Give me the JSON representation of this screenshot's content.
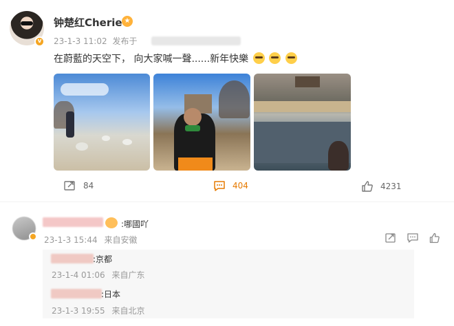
{
  "post": {
    "username": "钟楚红Cherie",
    "badge_icon": "crown-icon",
    "avatar_badge": "v",
    "time": "23-1-3 11:02",
    "source_prefix": "发布于",
    "text": "在蔚藍的天空下， 向大家喊一聲......新年快樂"
  },
  "actions": {
    "reposts": "84",
    "comments": "404",
    "likes": "4231"
  },
  "comment": {
    "text": ":哪國吖",
    "time": "23-1-3 15:44",
    "location": "来自安徽"
  },
  "replies": [
    {
      "text": ":京都",
      "time": "23-1-4 01:06",
      "location": "来自广东"
    },
    {
      "text": ":日本",
      "time": "23-1-3 19:55",
      "location": "来自北京"
    }
  ],
  "colors": {
    "accent": "#e67a00",
    "muted": "#999999",
    "text": "#333333"
  }
}
